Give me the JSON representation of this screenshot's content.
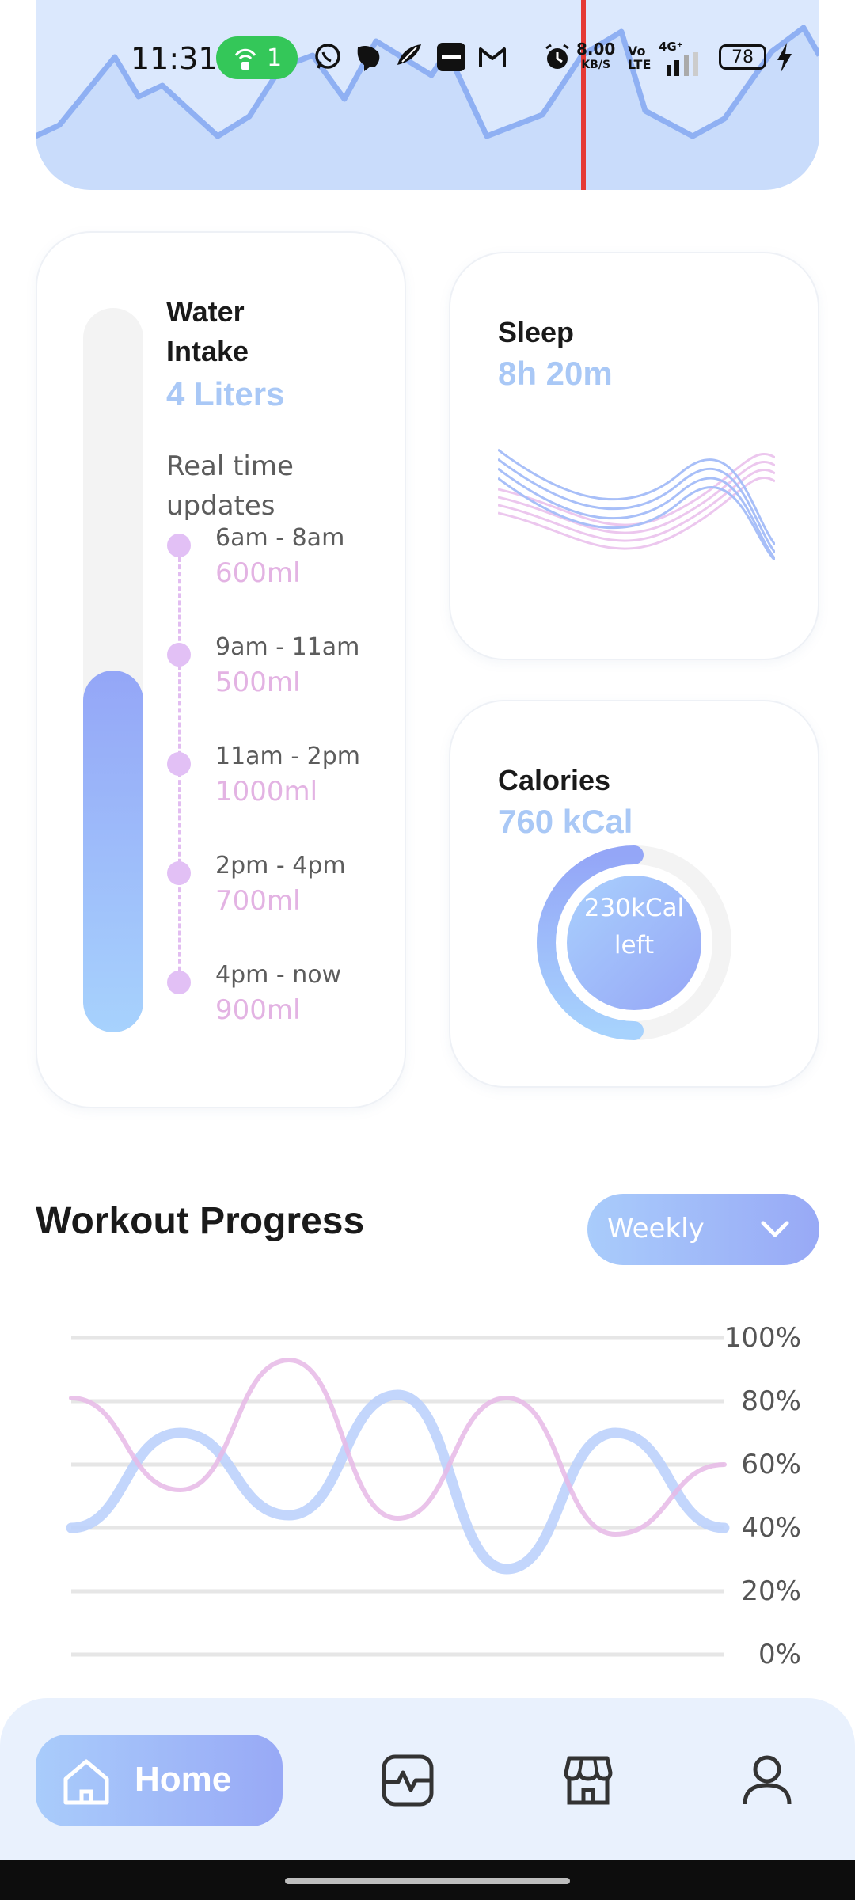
{
  "status_bar": {
    "time": "11:31",
    "hotspot_count": "1",
    "net_speed_value": "8.00",
    "net_speed_unit": "KB/S",
    "volte": "Vo\nLTE",
    "network_type": "4G⁺",
    "battery": "78"
  },
  "water": {
    "title": "Water\nIntake",
    "value": "4 Liters",
    "fill_fraction": 0.5,
    "realtime_label": "Real time\nupdates",
    "entries": [
      {
        "time": "6am - 8am",
        "amount": "600ml"
      },
      {
        "time": "9am - 11am",
        "amount": "500ml"
      },
      {
        "time": "11am - 2pm",
        "amount": "1000ml"
      },
      {
        "time": "2pm - 4pm",
        "amount": "700ml"
      },
      {
        "time": "4pm - now",
        "amount": "900ml"
      }
    ]
  },
  "sleep": {
    "title": "Sleep",
    "value": "8h 20m"
  },
  "calories": {
    "title": "Calories",
    "value": "760 kCal",
    "left_text": "230kCal\nleft",
    "progress_fraction": 0.5
  },
  "workout": {
    "title": "Workout Progress",
    "period": "Weekly",
    "chart_data": {
      "type": "line",
      "y_ticks": [
        "100%",
        "80%",
        "60%",
        "40%",
        "20%",
        "0%"
      ],
      "ylim": [
        0,
        100
      ],
      "series": [
        {
          "color": "#b9cffb",
          "values": [
            40,
            70,
            44,
            82,
            27,
            70,
            40
          ]
        },
        {
          "color": "#e6b9e6",
          "values": [
            81,
            52,
            93,
            43,
            81,
            38,
            60
          ]
        }
      ]
    }
  },
  "nav": {
    "home_label": "Home"
  },
  "colors": {
    "accent_blue": "#a9ccfb",
    "accent_purple": "#98a9f6",
    "pink": "#e3b3e3"
  }
}
